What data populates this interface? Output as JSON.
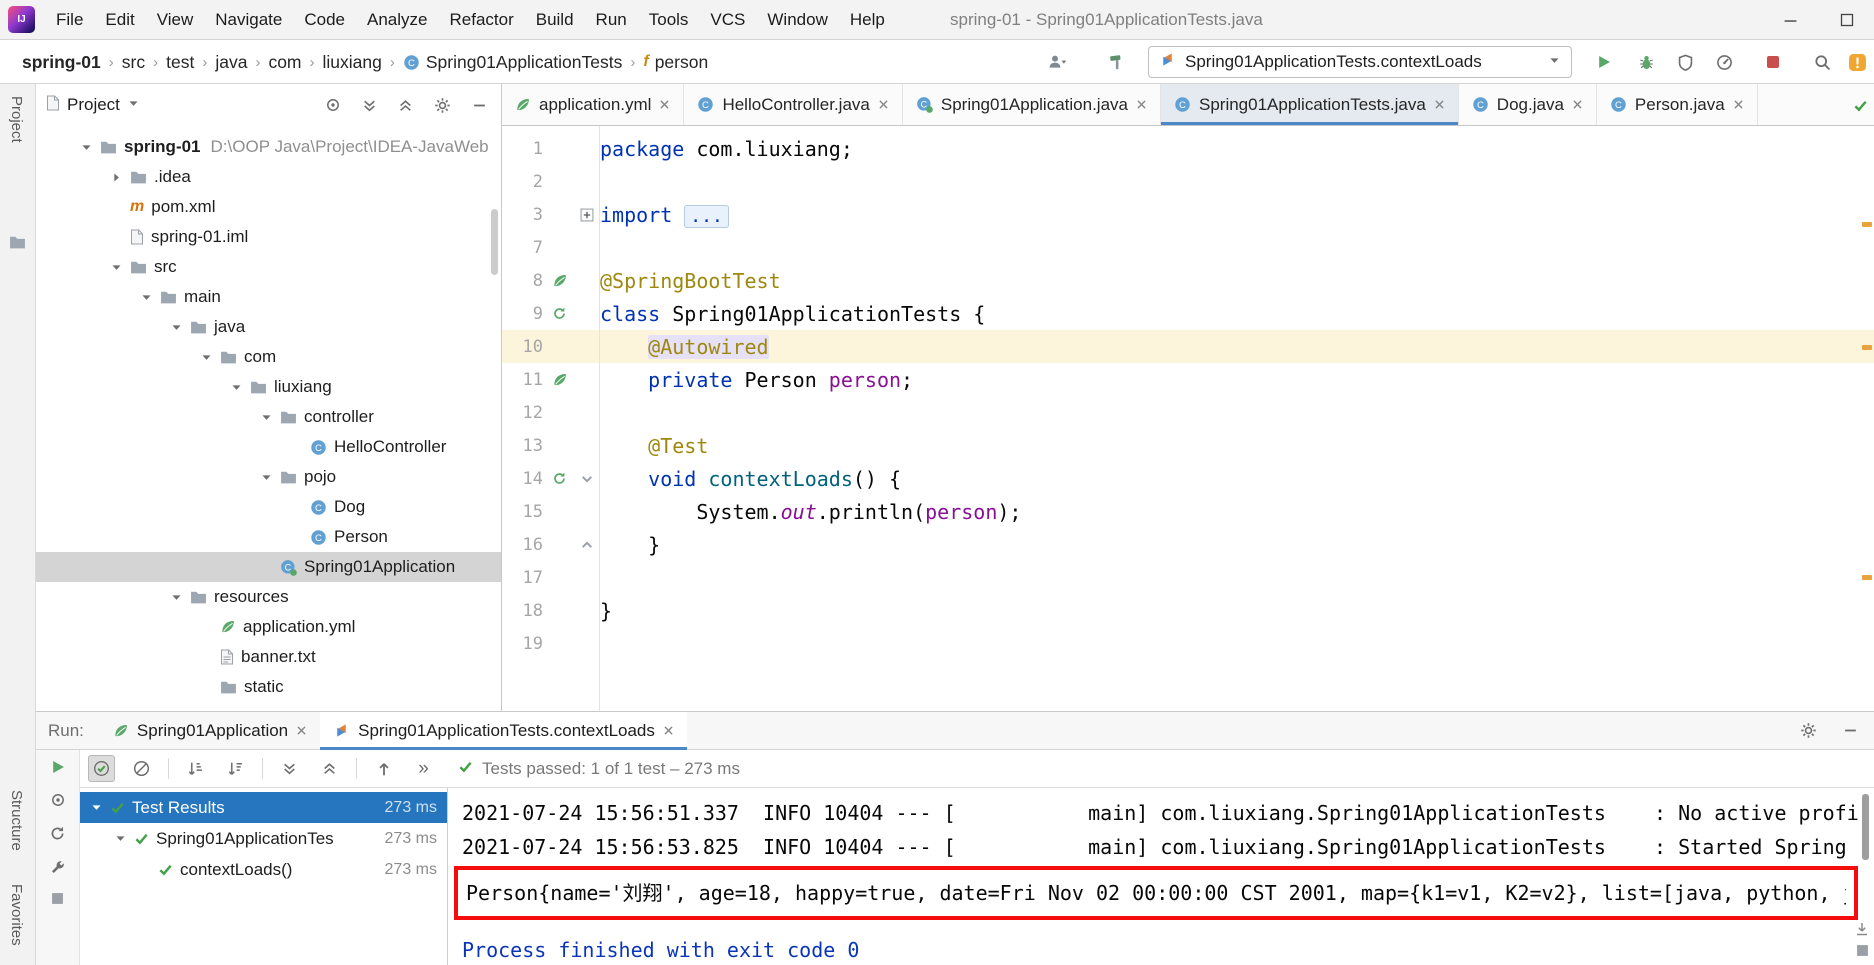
{
  "window": {
    "title": "spring-01 - Spring01ApplicationTests.java",
    "controls": [
      "minimize",
      "maximize"
    ]
  },
  "menubar": {
    "items": [
      "File",
      "Edit",
      "View",
      "Navigate",
      "Code",
      "Analyze",
      "Refactor",
      "Build",
      "Run",
      "Tools",
      "VCS",
      "Window",
      "Help"
    ]
  },
  "breadcrumbs": [
    {
      "label": "spring-01",
      "bold": true
    },
    {
      "label": "src"
    },
    {
      "label": "test"
    },
    {
      "label": "java"
    },
    {
      "label": "com"
    },
    {
      "label": "liuxiang"
    },
    {
      "label": "Spring01ApplicationTests",
      "icon": "class"
    },
    {
      "label": "person",
      "icon": "field"
    }
  ],
  "toolbar": {
    "run_config": "Spring01ApplicationTests.contextLoads",
    "right_icons": [
      "users",
      "build-hammer",
      "run",
      "debug",
      "run-with-coverage",
      "profiler",
      "stop",
      "search-everywhere",
      "notifications"
    ]
  },
  "stripes": {
    "project": "Project",
    "structure": "Structure",
    "favorites": "Favorites"
  },
  "project": {
    "title": "Project",
    "header_icons": [
      "locate",
      "expand-all",
      "collapse-all",
      "settings",
      "hide"
    ],
    "tree": [
      {
        "level": 0,
        "chevron": "down",
        "icon": "folder",
        "label": "spring-01",
        "bold": true,
        "suffix": "D:\\OOP Java\\Project\\IDEA-JavaWeb"
      },
      {
        "level": 1,
        "chevron": "right",
        "icon": "folder",
        "label": ".idea"
      },
      {
        "level": 1,
        "icon": "maven",
        "label": "pom.xml"
      },
      {
        "level": 1,
        "icon": "file",
        "label": "spring-01.iml"
      },
      {
        "level": 1,
        "chevron": "down",
        "icon": "folder",
        "label": "src"
      },
      {
        "level": 2,
        "chevron": "down",
        "icon": "folder",
        "label": "main"
      },
      {
        "level": 3,
        "chevron": "down",
        "icon": "folder",
        "label": "java"
      },
      {
        "level": 4,
        "chevron": "down",
        "icon": "folder",
        "label": "com"
      },
      {
        "level": 5,
        "chevron": "down",
        "icon": "folder",
        "label": "liuxiang"
      },
      {
        "level": 6,
        "chevron": "down",
        "icon": "folder",
        "label": "controller"
      },
      {
        "level": 7,
        "icon": "class",
        "label": "HelloController"
      },
      {
        "level": 6,
        "chevron": "down",
        "icon": "folder",
        "label": "pojo"
      },
      {
        "level": 7,
        "icon": "class",
        "label": "Dog"
      },
      {
        "level": 7,
        "icon": "class",
        "label": "Person"
      },
      {
        "level": 6,
        "icon": "class-spring",
        "label": "Spring01Application",
        "selected": true
      },
      {
        "level": 3,
        "chevron": "down",
        "icon": "folder",
        "label": "resources"
      },
      {
        "level": 4,
        "icon": "yml",
        "label": "application.yml"
      },
      {
        "level": 4,
        "icon": "txt",
        "label": "banner.txt"
      },
      {
        "level": 4,
        "icon": "folder",
        "label": "static"
      }
    ]
  },
  "editor": {
    "tabs": [
      {
        "label": "application.yml",
        "icon": "yml"
      },
      {
        "label": "HelloController.java",
        "icon": "class"
      },
      {
        "label": "Spring01Application.java",
        "icon": "class-spring"
      },
      {
        "label": "Spring01ApplicationTests.java",
        "icon": "class",
        "active": true
      },
      {
        "label": "Dog.java",
        "icon": "class"
      },
      {
        "label": "Person.java",
        "icon": "class"
      }
    ],
    "lines": [
      {
        "n": "1",
        "segs": [
          [
            "kw",
            "package "
          ],
          [
            "pln",
            "com.liuxiang;"
          ]
        ]
      },
      {
        "n": "2",
        "segs": []
      },
      {
        "n": "3",
        "fold": "plus",
        "segs": [
          [
            "kw",
            "import "
          ],
          [
            "foldbox",
            "..."
          ]
        ]
      },
      {
        "n": "7",
        "segs": []
      },
      {
        "n": "8",
        "gutter": "leaf",
        "segs": [
          [
            "ann",
            "@SpringBootTest"
          ]
        ]
      },
      {
        "n": "9",
        "gutter": "run",
        "segs": [
          [
            "kw",
            "class "
          ],
          [
            "pln",
            "Spring01ApplicationTests {"
          ]
        ]
      },
      {
        "n": "10",
        "current": true,
        "segs": [
          [
            "pln",
            "    "
          ],
          [
            "annhl",
            "@Autowired"
          ]
        ]
      },
      {
        "n": "11",
        "gutter": "bean",
        "segs": [
          [
            "pln",
            "    "
          ],
          [
            "kw",
            "private "
          ],
          [
            "pln",
            "Person "
          ],
          [
            "fd",
            "person"
          ],
          [
            "pln",
            ";"
          ]
        ]
      },
      {
        "n": "12",
        "segs": []
      },
      {
        "n": "13",
        "segs": [
          [
            "pln",
            "    "
          ],
          [
            "ann",
            "@Test"
          ]
        ]
      },
      {
        "n": "14",
        "gutter": "run",
        "fold": "down",
        "segs": [
          [
            "pln",
            "    "
          ],
          [
            "kw",
            "void "
          ],
          [
            "mth",
            "contextLoads"
          ],
          [
            "pln",
            "() {"
          ]
        ]
      },
      {
        "n": "15",
        "segs": [
          [
            "pln",
            "        System."
          ],
          [
            "fdi",
            "out"
          ],
          [
            "pln",
            ".println("
          ],
          [
            "fd",
            "person"
          ],
          [
            "pln",
            ");"
          ]
        ]
      },
      {
        "n": "16",
        "fold": "up",
        "segs": [
          [
            "pln",
            "    }"
          ]
        ]
      },
      {
        "n": "17",
        "segs": []
      },
      {
        "n": "18",
        "segs": [
          [
            "pln",
            "}"
          ]
        ]
      },
      {
        "n": "19",
        "segs": []
      }
    ]
  },
  "run": {
    "label": "Run:",
    "tabs": [
      {
        "label": "Spring01Application",
        "icon": "spring"
      },
      {
        "label": "Spring01ApplicationTests.contextLoads",
        "icon": "junit",
        "active": true
      }
    ],
    "tab_right_icons": [
      "settings",
      "hide"
    ],
    "toolbar_icons": [
      "show-passed",
      "show-ignored",
      "sort-alphabetically",
      "sort-by-duration",
      "expand-all",
      "collapse-all",
      "previous-occurrence",
      "more-options"
    ],
    "left_icons": [
      "rerun-tests",
      "toggle-auto-test",
      "rerun-auto",
      "test-settings",
      "pin-tab"
    ],
    "status": "Tests passed: 1 of 1 test – 273 ms",
    "tests": [
      {
        "level": 0,
        "chevron": "down",
        "label": "Test Results",
        "time": "273 ms",
        "selected": true
      },
      {
        "level": 1,
        "chevron": "down",
        "label": "Spring01ApplicationTes",
        "time": "273 ms"
      },
      {
        "level": 2,
        "label": "contextLoads()",
        "time": "273 ms"
      }
    ],
    "console": [
      {
        "kind": "log",
        "text": "2021-07-24 15:56:51.337  INFO 10404 --- [           main] com.liuxiang.Spring01ApplicationTests    : No active profi"
      },
      {
        "kind": "log",
        "text": "2021-07-24 15:56:53.825  INFO 10404 --- [           main] com.liuxiang.Spring01ApplicationTests    : Started Spring"
      },
      {
        "kind": "log",
        "boxed": true,
        "text": "Person{name='刘翔', age=18, happy=true, date=Fri Nov 02 00:00:00 CST 2001, map={k1=v1, K2=v2}, list=[java, python, j"
      },
      {
        "kind": "system",
        "text": "Process finished with exit code 0"
      }
    ]
  },
  "colors": {
    "accent_blue": "#4A88C7",
    "selection_blue": "#2675BF",
    "selection_gray": "#D4D4D4",
    "run_green": "#59A869",
    "stop_red": "#C94F4C",
    "error_box_red": "#F50D0D",
    "keyword": "#0033B3",
    "annotation": "#9E880D",
    "field": "#871094",
    "method": "#00627A"
  }
}
